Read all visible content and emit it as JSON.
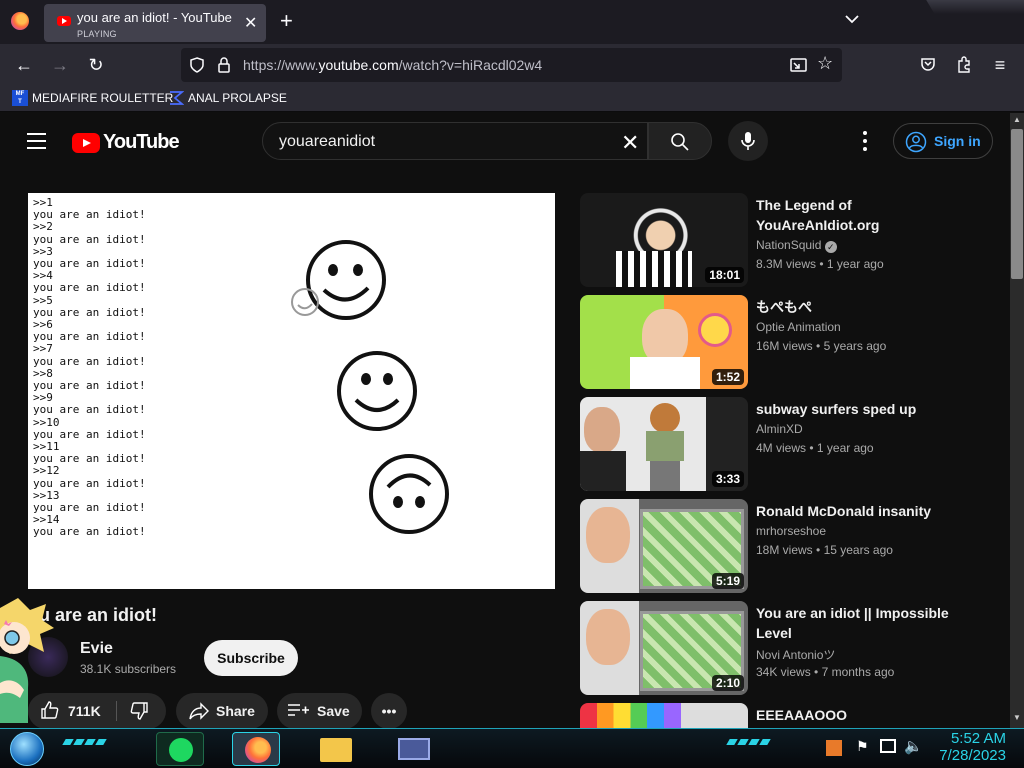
{
  "browser": {
    "tab": {
      "title": "you are an idiot! - YouTube",
      "status": "PLAYING"
    },
    "url": {
      "prefix": "https://www.",
      "domain": "youtube.com",
      "path": "/watch?v=hiRacdl02w4"
    },
    "bookmarks": [
      {
        "label": "MEDIAFIRE ROULETTER",
        "icon": "mediafire-icon"
      },
      {
        "label": "ANAL PROLAPSE",
        "icon": "sigma-icon"
      }
    ]
  },
  "youtube": {
    "logo_text": "YouTube",
    "search_query": "youareanidiot",
    "sign_in": "Sign in",
    "player": {
      "log": ">>1\nyou are an idiot!\n>>2\nyou are an idiot!\n>>3\nyou are an idiot!\n>>4\nyou are an idiot!\n>>5\nyou are an idiot!\n>>6\nyou are an idiot!\n>>7\nyou are an idiot!\n>>8\nyou are an idiot!\n>>9\nyou are an idiot!\n>>10\nyou are an idiot!\n>>11\nyou are an idiot!\n>>12\nyou are an idiot!\n>>13\nyou are an idiot!\n>>14\nyou are an idiot!"
    },
    "video": {
      "title": "ou are an idiot!",
      "channel": "Evie",
      "subscribers": "38.1K subscribers",
      "subscribe": "Subscribe",
      "likes": "711K",
      "share": "Share",
      "save": "Save"
    },
    "recommendations": [
      {
        "title": "The Legend of YouAreAnIdiot.org",
        "channel": "NationSquid",
        "verified": true,
        "views": "8.3M views",
        "age": "1 year ago",
        "duration": "18:01"
      },
      {
        "title": "もぺもぺ",
        "channel": "Optie Animation",
        "views": "16M views",
        "age": "5 years ago",
        "duration": "1:52"
      },
      {
        "title": "subway surfers sped up",
        "channel": "AlminXD",
        "views": "4M views",
        "age": "1 year ago",
        "duration": "3:33"
      },
      {
        "title": "Ronald McDonald insanity",
        "channel": "mrhorseshoe",
        "views": "18M views",
        "age": "15 years ago",
        "duration": "5:19"
      },
      {
        "title": "You are an idiot || Impossible Level",
        "channel": "Novi Antonioツ",
        "views": "34K views",
        "age": "7 months ago",
        "duration": "2:10"
      },
      {
        "title": "EEEAAAOOO",
        "channel": "",
        "views": "",
        "age": "",
        "duration": ""
      }
    ]
  },
  "taskbar": {
    "time": "5:52 AM",
    "date": "7/28/2023"
  },
  "colors": {
    "accent": "#3ea6ff",
    "brand_red": "#ff0000",
    "taskbar_cyan": "#2ad3e6"
  }
}
